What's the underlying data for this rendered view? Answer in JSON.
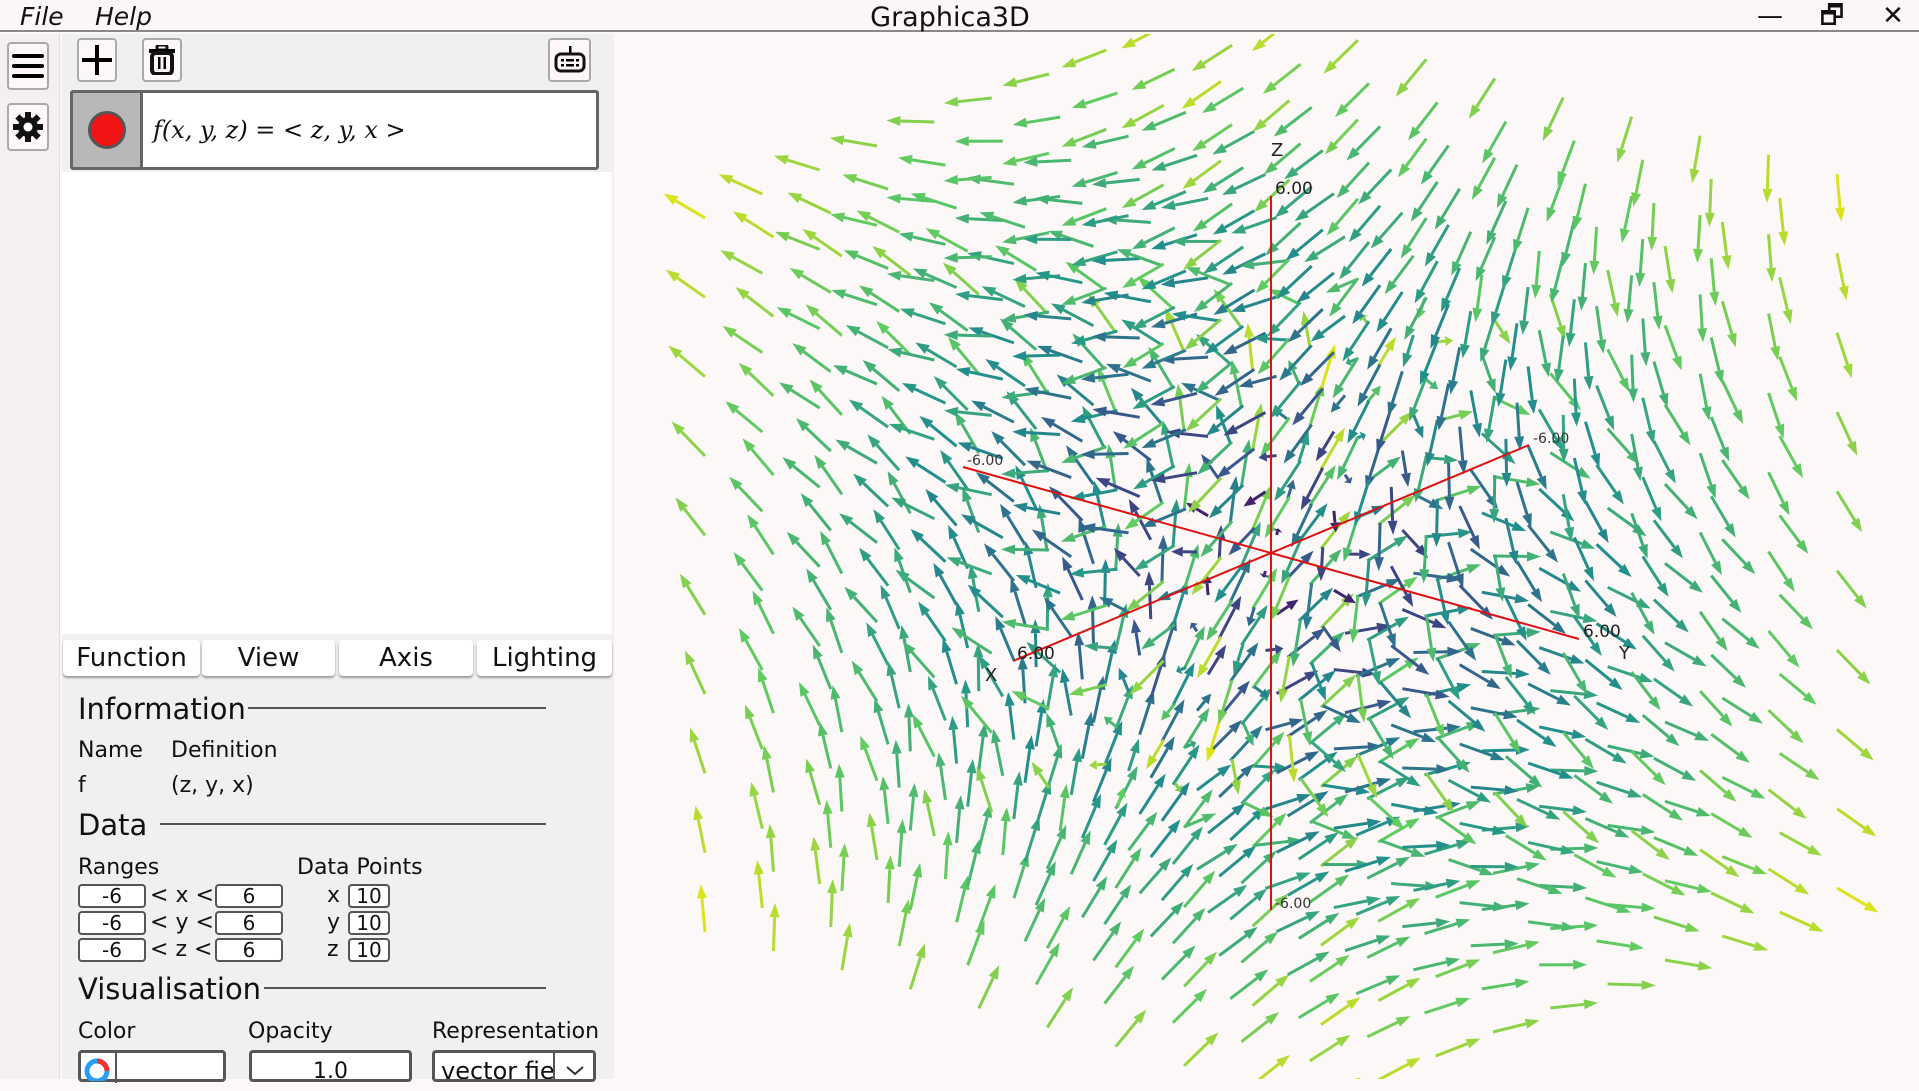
{
  "menubar": {
    "file": "File",
    "help": "Help",
    "title": "Graphica3D",
    "minimize": "—",
    "maximize": "🗗",
    "close": "✕"
  },
  "sidebar": {
    "menu_icon": "hamburger-icon",
    "settings_icon": "gear-icon"
  },
  "toolbar": {
    "add_icon": "plus-icon",
    "delete_icon": "trash-icon",
    "keyboard_icon": "keyboard-icon"
  },
  "function_list": [
    {
      "expression": "f(x, y, z) = < z, y, x >",
      "color": "#f01414"
    }
  ],
  "tabs": [
    "Function",
    "View",
    "Axis",
    "Lighting"
  ],
  "information": {
    "heading": "Information",
    "name_header": "Name",
    "definition_header": "Definition",
    "name": "f",
    "definition": "(z, y, x)"
  },
  "data": {
    "heading": "Data",
    "ranges_label": "Ranges",
    "points_label": "Data Points",
    "ranges": [
      {
        "var": "x",
        "min": "-6",
        "max": "6",
        "points": "10"
      },
      {
        "var": "y",
        "min": "-6",
        "max": "6",
        "points": "10"
      },
      {
        "var": "z",
        "min": "-6",
        "max": "6",
        "points": "10"
      }
    ],
    "lt": "<"
  },
  "visualisation": {
    "heading": "Visualisation",
    "color_label": "Color",
    "opacity_label": "Opacity",
    "opacity": "1.0",
    "representation_label": "Representation",
    "representation": "vector fie"
  },
  "plot": {
    "axes": {
      "x_label": "X",
      "y_label": "Y",
      "z_label": "Z",
      "x_pos": "6.00",
      "x_neg": "-6.00",
      "y_pos": "6.00",
      "y_neg": "-6.00",
      "z_pos": "6.00",
      "z_neg": "-6.00"
    },
    "axis_color": "#dd1111"
  },
  "chart_data": {
    "type": "vector-field-3d",
    "function": "f(x,y,z) = <z, y, x>",
    "xlim": [
      -6,
      6
    ],
    "ylim": [
      -6,
      6
    ],
    "zlim": [
      -6,
      6
    ],
    "points_per_axis": [
      10,
      10,
      10
    ],
    "colormap": "viridis (by magnitude)"
  }
}
